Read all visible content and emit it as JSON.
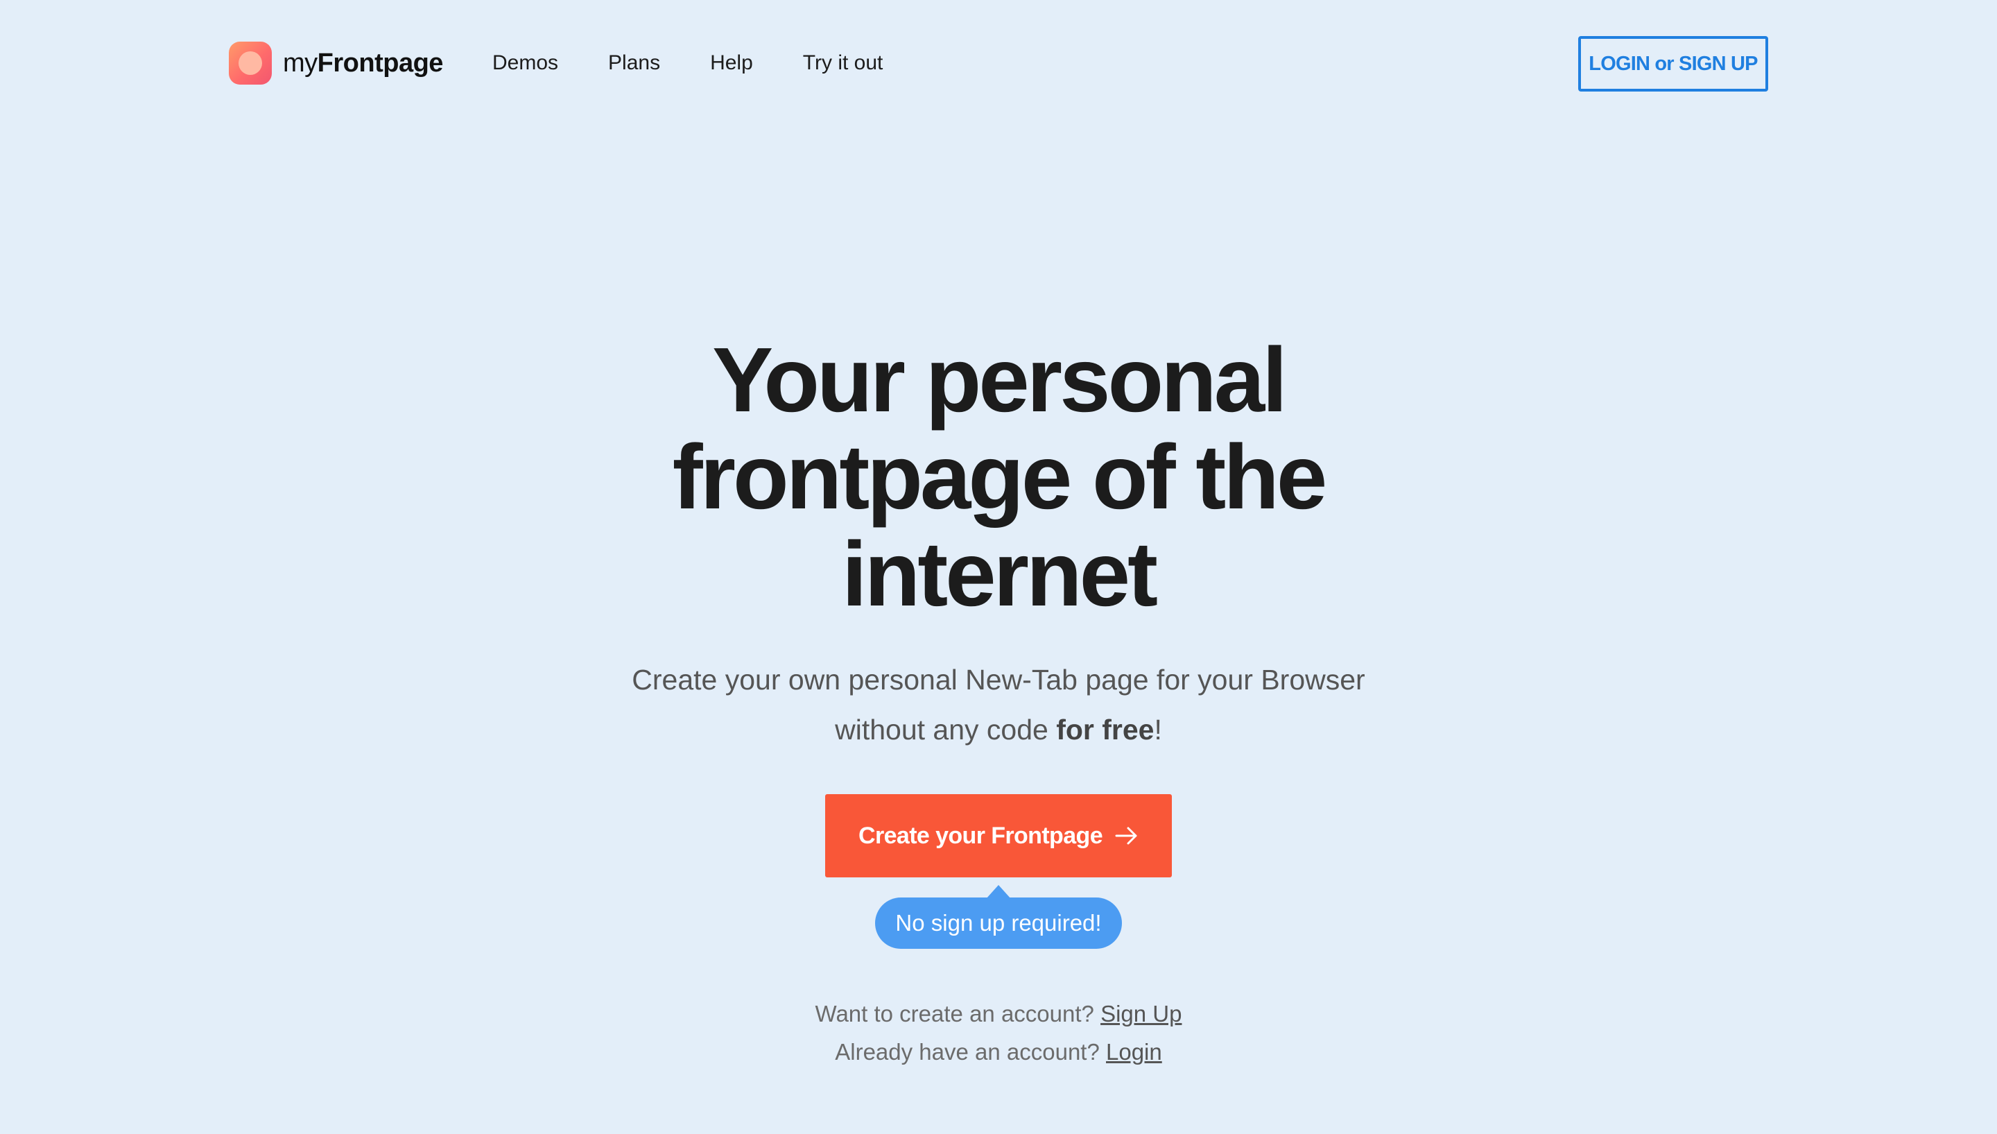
{
  "brand": {
    "name_light": "my",
    "name_bold": "Frontpage",
    "logo_icon": "app-logo-icon",
    "logo_colors": [
      "#ff9b6a",
      "#ff6b6b",
      "#f2566f"
    ]
  },
  "nav": {
    "items": [
      {
        "label": "Demos"
      },
      {
        "label": "Plans"
      },
      {
        "label": "Help"
      },
      {
        "label": "Try it out"
      }
    ]
  },
  "header": {
    "login_label": "LOGIN or SIGN UP"
  },
  "hero": {
    "title_lines": [
      "Your personal",
      "frontpage of the",
      "internet"
    ],
    "subtitle_line1": "Create your own personal New-Tab page for your Browser",
    "subtitle_line2_prefix": "without any code ",
    "subtitle_line2_bold": "for free",
    "subtitle_line2_suffix": "!",
    "cta_label": "Create your Frontpage",
    "cta_icon": "arrow-right-icon",
    "tooltip": "No sign up required!"
  },
  "account": {
    "signup_prompt": "Want to create an account? ",
    "signup_link": "Sign Up",
    "login_prompt": "Already have an account? ",
    "login_link": "Login"
  },
  "colors": {
    "background": "#e3eef9",
    "accent_blue": "#1f7fe0",
    "cta_orange": "#f95738",
    "tooltip_blue": "#4c9cf2",
    "text_dark": "#1c1c1c"
  }
}
